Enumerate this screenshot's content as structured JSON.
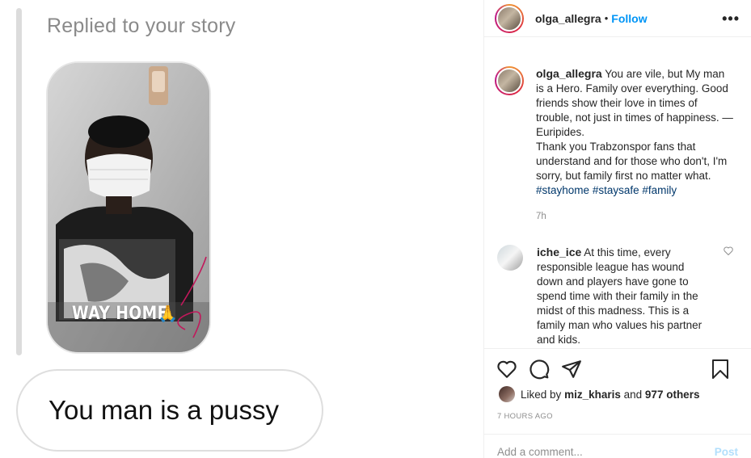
{
  "story_reply": {
    "caption": "Replied to your story",
    "story_overlay_text": "WAY HOME",
    "emoji": "🙏",
    "message": "You man is a pussy"
  },
  "post": {
    "header": {
      "username": "olga_allegra",
      "separator": "•",
      "follow_label": "Follow",
      "more_icon": "more-options-icon"
    },
    "caption": {
      "username": "olga_allegra",
      "text": "You are vile, but My man is a Hero. Family over everything. Good friends show their love in times of trouble, not just in times of happiness. — Euripides.\nThank you Trabzonspor fans that understand and for those who don't, I'm sorry, but family first no matter what.",
      "hashtags": [
        "#stayhome",
        "#staysafe",
        "#family"
      ],
      "time": "7h"
    },
    "comments": [
      {
        "username": "iche_ice",
        "text": "At this time, every responsible league has wound down and players have gone to spend time with their family in the midst of this madness. This is a family man who values his partner and kids."
      }
    ],
    "actions": {
      "icons": [
        "heart-icon",
        "comment-icon",
        "share-icon",
        "bookmark-icon"
      ]
    },
    "likes": {
      "prefix": "Liked by",
      "user": "miz_kharis",
      "joiner": "and",
      "others": "977 others"
    },
    "time_ago": "7 HOURS AGO",
    "add_comment": {
      "placeholder": "Add a comment...",
      "post_label": "Post"
    }
  },
  "colors": {
    "link_blue": "#0095f6",
    "hashtag_blue": "#00376b",
    "muted_gray": "#8e8e8e",
    "post_disabled": "#b2dffc"
  }
}
